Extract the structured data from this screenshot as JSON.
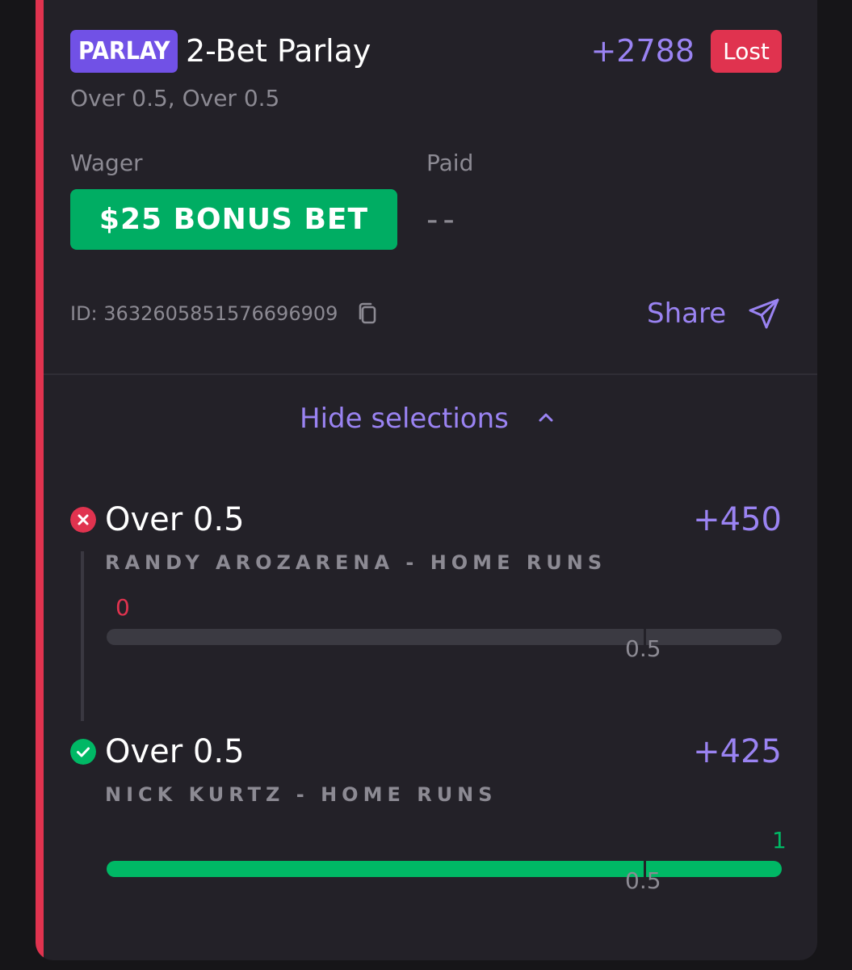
{
  "bet": {
    "tag": "PARLAY",
    "title": "2-Bet Parlay",
    "odds": "+2788",
    "status": "Lost",
    "subtitle": "Over 0.5, Over 0.5",
    "wager_label": "Wager",
    "wager_value": "$25 BONUS BET",
    "paid_label": "Paid",
    "paid_value": "--",
    "id_text": "ID: 3632605851576696909",
    "share_label": "Share",
    "hide_label": "Hide selections"
  },
  "selections": [
    {
      "title": "Over 0.5",
      "odds": "+450",
      "subtitle": "RANDY AROZARENA - HOME RUNS",
      "result": "lost",
      "current": "0",
      "line": "0.5",
      "progress": 0
    },
    {
      "title": "Over 0.5",
      "odds": "+425",
      "subtitle": "NICK KURTZ - HOME RUNS",
      "result": "won",
      "current": "1",
      "line": "0.5",
      "progress": 1
    }
  ],
  "colors": {
    "accent": "#7151e6",
    "odds": "#9a83f2",
    "lost": "#e0334f",
    "won": "#00b865",
    "bonus": "#00ad63"
  },
  "icons": [
    "copy-icon",
    "send-icon",
    "chevron-up-icon",
    "x-circle-icon",
    "check-circle-icon"
  ]
}
